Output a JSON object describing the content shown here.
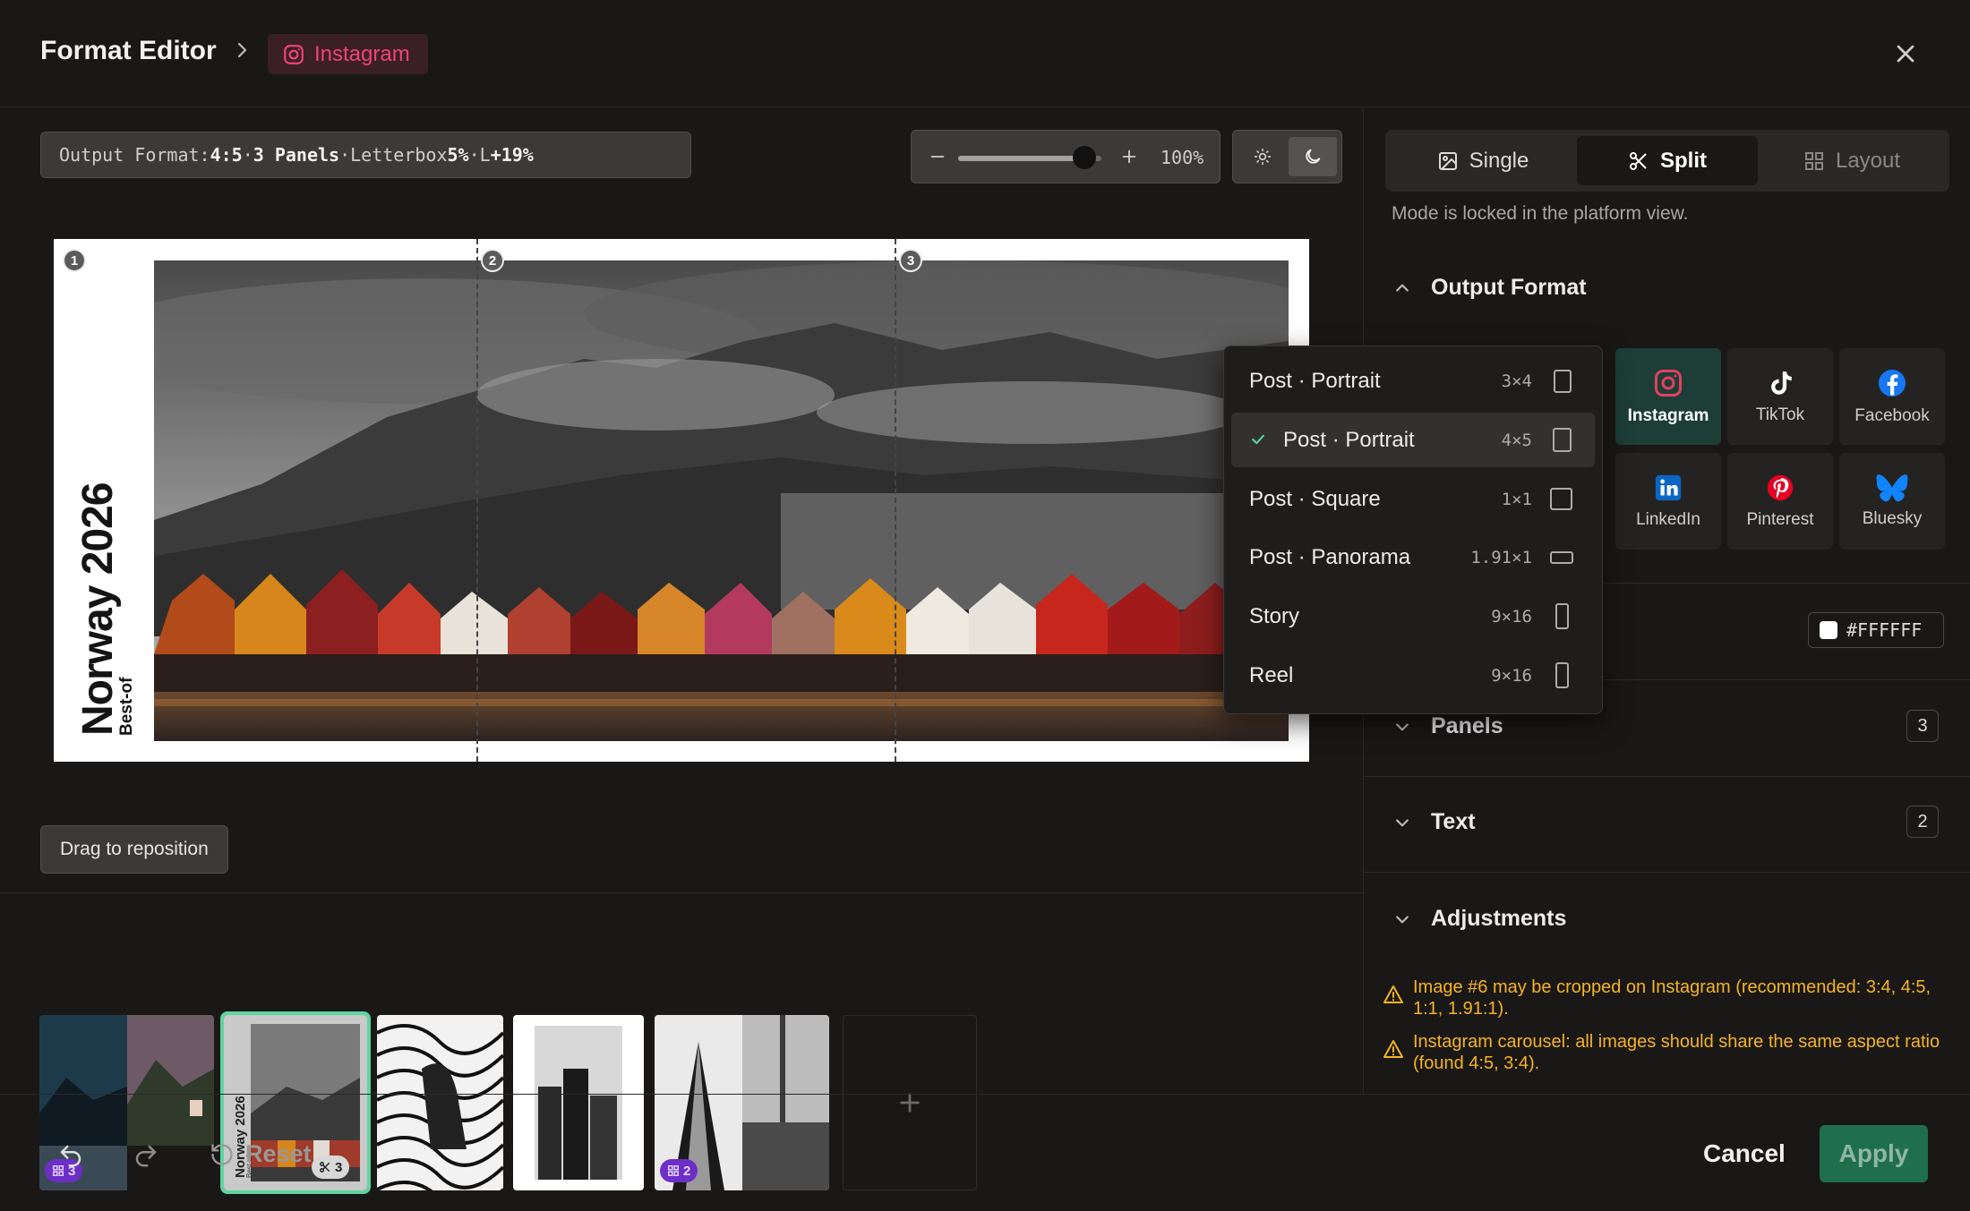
{
  "header": {
    "title": "Format Editor",
    "platform": "Instagram"
  },
  "canvas": {
    "info": {
      "label": "Output Format:",
      "ratio": "4:5",
      "sep1": "·",
      "panels": "3 Panels",
      "sep2": "·",
      "letterbox_label": "Letterbox",
      "letterbox_value": "5%",
      "sep3": "·",
      "l_label": "L",
      "l_value": "+19%"
    },
    "zoom": {
      "value": "100%",
      "level": 0.88
    },
    "vertical_title": "Norway 2026",
    "vertical_subtitle": "Best-of",
    "panel_numbers": [
      "1",
      "2",
      "3"
    ],
    "drag_label": "Drag to reposition"
  },
  "thumbnails": {
    "items": [
      {
        "badge": "3",
        "badge_style": "purple",
        "selected": false
      },
      {
        "badge": "3",
        "badge_style": "gray",
        "selected": true,
        "caption": "Norway 2026",
        "caption_sub": "Best-of"
      },
      {
        "badge": "",
        "selected": false
      },
      {
        "badge": "",
        "selected": false
      },
      {
        "badge": "2",
        "badge_style": "purple",
        "selected": false
      }
    ]
  },
  "modes": {
    "tabs": [
      {
        "label": "Single",
        "icon": "image-icon",
        "state": "normal"
      },
      {
        "label": "Split",
        "icon": "scissors-icon",
        "state": "active"
      },
      {
        "label": "Layout",
        "icon": "grid-icon",
        "state": "disabled"
      }
    ],
    "note": "Mode is locked in the platform view."
  },
  "output_format": {
    "title": "Output Format",
    "platforms": [
      {
        "label": "Instagram",
        "color": "#e4405f",
        "active": true
      },
      {
        "label": "TikTok",
        "color": "#ffffff",
        "active": false
      },
      {
        "label": "Facebook",
        "color": "#1877f2",
        "active": false
      },
      {
        "label": "LinkedIn",
        "color": "#0a66c2",
        "active": false
      },
      {
        "label": "Pinterest",
        "color": "#e60023",
        "active": false
      },
      {
        "label": "Bluesky",
        "color": "#1185fe",
        "active": false
      }
    ],
    "background_color": "#FFFFFF"
  },
  "sections": {
    "panels": {
      "title": "Panels",
      "count": "3"
    },
    "text": {
      "title": "Text",
      "count": "2"
    },
    "adjustments": {
      "title": "Adjustments"
    }
  },
  "warnings": [
    "Image #6 may be cropped on Instagram (recommended: 3:4, 4:5, 1:1, 1.91:1).",
    "Instagram carousel: all images should share the same aspect ratio (found 4:5, 3:4)."
  ],
  "dropdown": {
    "options": [
      {
        "label": "Post · Portrait",
        "ratio": "3×4",
        "selected": false
      },
      {
        "label": "Post · Portrait",
        "ratio": "4×5",
        "selected": true
      },
      {
        "label": "Post · Square",
        "ratio": "1×1",
        "selected": false
      },
      {
        "label": "Post · Panorama",
        "ratio": "1.91×1",
        "selected": false
      },
      {
        "label": "Story",
        "ratio": "9×16",
        "selected": false
      },
      {
        "label": "Reel",
        "ratio": "9×16",
        "selected": false
      }
    ]
  },
  "footer": {
    "reset": "Reset",
    "cancel": "Cancel",
    "apply": "Apply"
  },
  "colors": {
    "accent": "#5fd4a0",
    "instagram": "#f0427a",
    "warning": "#f5b423",
    "apply_bg": "#1f6e4c"
  }
}
